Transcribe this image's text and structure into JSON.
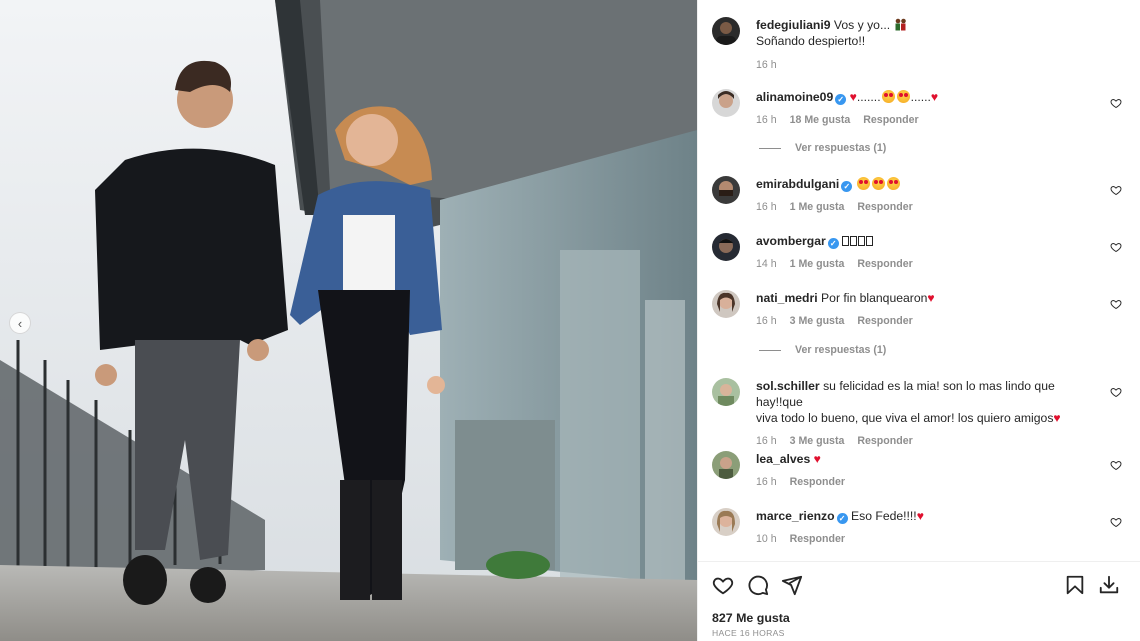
{
  "caption": {
    "username": "fedegiuliani9",
    "text_line1": "Vos y yo...",
    "text_line2": "Soñando despierto!!",
    "time": "16 h"
  },
  "comments": [
    {
      "username": "alinamoine09",
      "verified": true,
      "text": ".......",
      "text2": "......",
      "time": "16 h",
      "likes": "18 Me gusta",
      "reply": "Responder",
      "view_replies": "Ver respuestas (1)"
    },
    {
      "username": "emirabdulgani",
      "verified": true,
      "text": "",
      "time": "16 h",
      "likes": "1 Me gusta",
      "reply": "Responder"
    },
    {
      "username": "avombergar",
      "verified": true,
      "text": "",
      "time": "14 h",
      "likes": "1 Me gusta",
      "reply": "Responder"
    },
    {
      "username": "nati_medri",
      "verified": false,
      "text": "Por fin blanquearon",
      "time": "16 h",
      "likes": "3 Me gusta",
      "reply": "Responder",
      "view_replies": "Ver respuestas (1)"
    },
    {
      "username": "sol.schiller",
      "verified": false,
      "text": "su felicidad es la mia! son lo mas lindo que hay!!que",
      "text2": "viva todo lo bueno, que viva el amor! los quiero amigos",
      "time": "16 h",
      "likes": "3 Me gusta",
      "reply": "Responder"
    },
    {
      "username": "lea_alves",
      "verified": false,
      "text": "",
      "time": "16 h",
      "reply": "Responder"
    },
    {
      "username": "marce_rienzo",
      "verified": true,
      "text": "Eso Fede!!!!",
      "time": "10 h",
      "reply": "Responder"
    }
  ],
  "icons": {
    "like": "heart-icon",
    "comment": "comment-icon",
    "share": "share-icon",
    "save": "bookmark-icon",
    "download": "download-icon",
    "prev": "chevron-left-icon"
  },
  "footer": {
    "likes": "827 Me gusta",
    "time_ago": "HACE 16 HORAS"
  },
  "colors": {
    "text": "#262626",
    "muted": "#8e8e8e",
    "verified": "#3897f0",
    "heart": "#e0102e"
  }
}
